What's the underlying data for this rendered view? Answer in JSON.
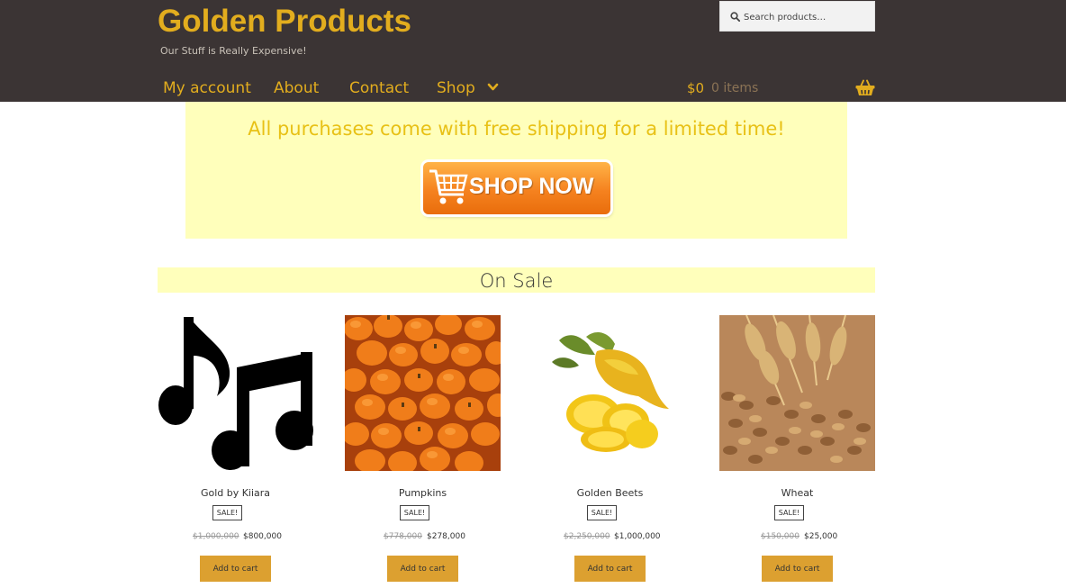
{
  "site": {
    "title": "Golden Products",
    "tagline": "Our Stuff is Really Expensive!",
    "brand_color": "#e2ad1e",
    "header_bg": "#3b3434"
  },
  "search": {
    "placeholder": "Search products…",
    "icon": "search-icon"
  },
  "nav": {
    "items": [
      {
        "label": "My account"
      },
      {
        "label": "About"
      },
      {
        "label": "Contact"
      },
      {
        "label": "Shop",
        "icon": "chevron-down-icon"
      }
    ]
  },
  "cart": {
    "total": "$0",
    "count": "0 items",
    "icon": "basket-icon"
  },
  "banner": {
    "text": "All purchases come with free shipping for a limited time!",
    "button_label": "SHOP NOW",
    "bg_color": "#ffffbb"
  },
  "section": {
    "title": "On Sale"
  },
  "products": [
    {
      "name": "Gold by Kiiara",
      "badge": "SALE!",
      "old_price": "$1,000,000",
      "new_price": "$800,000",
      "button": "Add to cart",
      "image": "music-notes-image"
    },
    {
      "name": "Pumpkins",
      "badge": "SALE!",
      "old_price": "$778,000",
      "new_price": "$278,000",
      "button": "Add to cart",
      "image": "pumpkins-image"
    },
    {
      "name": "Golden Beets",
      "badge": "SALE!",
      "old_price": "$2,250,000",
      "new_price": "$1,000,000",
      "button": "Add to cart",
      "image": "golden-beets-image"
    },
    {
      "name": "Wheat",
      "badge": "SALE!",
      "old_price": "$150,000",
      "new_price": "$25,000",
      "button": "Add to cart",
      "image": "wheat-image"
    }
  ]
}
